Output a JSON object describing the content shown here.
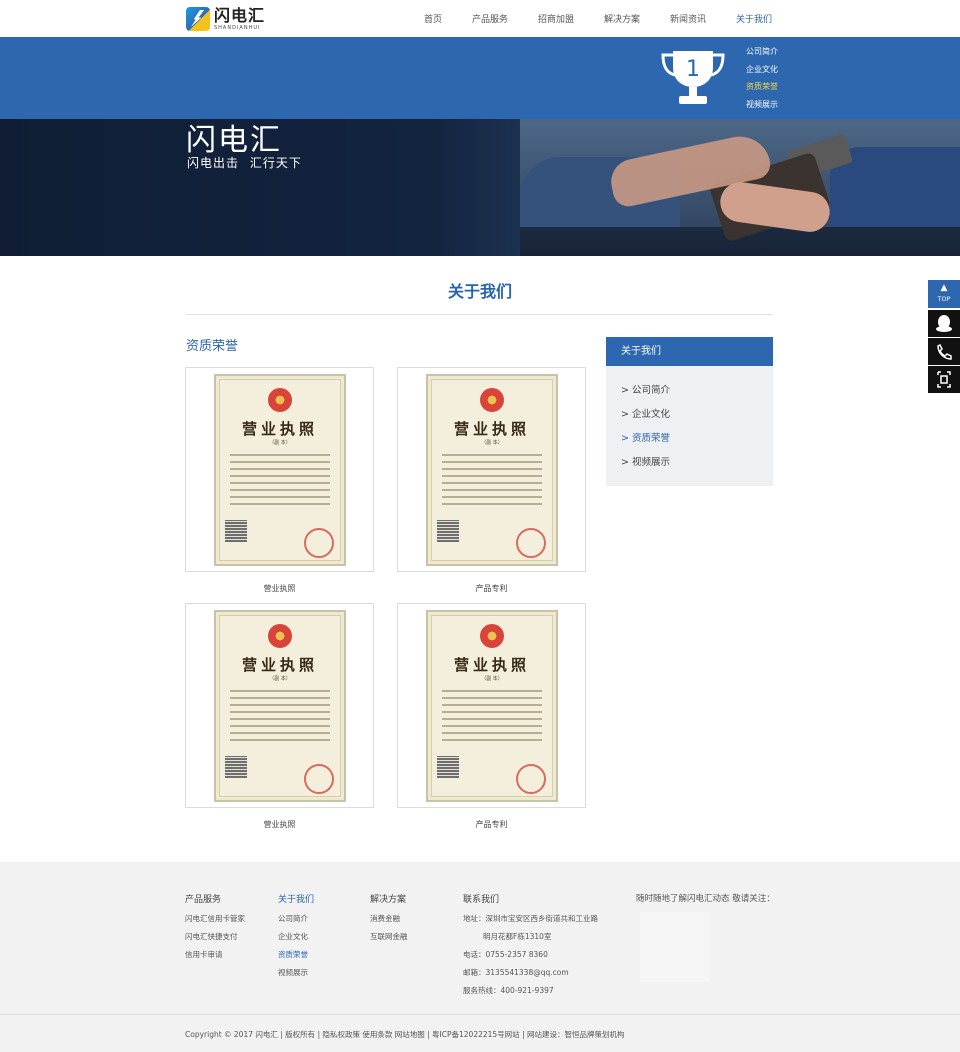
{
  "header": {
    "logo_cn": "闪电汇",
    "logo_en": "SHANDIANHUI",
    "nav": [
      {
        "label": "首页"
      },
      {
        "label": "产品服务"
      },
      {
        "label": "招商加盟"
      },
      {
        "label": "解决方案"
      },
      {
        "label": "新闻资讯"
      },
      {
        "label": "关于我们"
      }
    ],
    "dropdown": [
      "公司简介",
      "企业文化",
      "资质荣誉",
      "视频展示"
    ],
    "trophy_number": "1"
  },
  "banner": {
    "title": "闪电汇",
    "subtitle": "闪电出击  汇行天下"
  },
  "main": {
    "section_title": "关于我们",
    "page_title": "资质荣誉",
    "certificates": [
      {
        "doc_title": "营业执照",
        "doc_sub": "（副 本）",
        "caption": "营业执照"
      },
      {
        "doc_title": "营业执照",
        "doc_sub": "（副 本）",
        "caption": "产品专利"
      },
      {
        "doc_title": "营业执照",
        "doc_sub": "（副 本）",
        "caption": "营业执照"
      },
      {
        "doc_title": "营业执照",
        "doc_sub": "（副 本）",
        "caption": "产品专利"
      }
    ]
  },
  "sidebar": {
    "heading": "关于我们",
    "items": [
      "> 公司简介",
      "> 企业文化",
      "> 资质荣誉",
      "> 视频展示"
    ],
    "active_index": 2
  },
  "float_tools": {
    "top_arrow": "▲",
    "top_label": "TOP",
    "icons": [
      "qq-icon",
      "phone-icon",
      "qrcode-icon"
    ]
  },
  "footer": {
    "columns": [
      {
        "heading": "产品服务",
        "links": [
          "闪电汇信用卡管家",
          "闪电汇快捷支付",
          "信用卡审请"
        ]
      },
      {
        "heading": "关于我们",
        "links": [
          "公司简介",
          "企业文化",
          "资质荣誉",
          "视频展示"
        ]
      },
      {
        "heading": "解决方案",
        "links": [
          "消费金融",
          "互联网金融"
        ]
      },
      {
        "heading": "联系我们",
        "links": [
          "地址：深圳市宝安区西乡街道共和工业路",
          "明月花都F栋1310室",
          "电话：0755-2357 8360",
          "邮箱：3135541338@qq.com",
          "服务热线：400-921-9397"
        ]
      }
    ],
    "follow_note": "随时随地了解闪电汇动态 敬请关注：",
    "copyright": "Copyright © 2017 闪电汇    |    版权所有    |    隐私权政策    使用条款    网站地图    |    粤ICP备12022215号网站    |    网站建设：智恒品牌策划机构"
  },
  "colors": {
    "brand_blue": "#2d67b0",
    "active_text": "#2a64ad",
    "dropdown_active": "#f5d84a"
  }
}
